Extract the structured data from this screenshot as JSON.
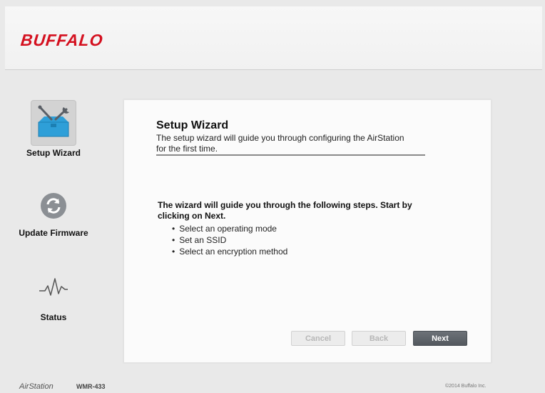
{
  "header": {
    "logo": "BUFFALO"
  },
  "sidebar": {
    "items": [
      {
        "label": "Setup Wizard",
        "icon": "toolbox-wrench-icon",
        "active": true
      },
      {
        "label": "Update Firmware",
        "icon": "refresh-icon",
        "active": false
      },
      {
        "label": "Status",
        "icon": "pulse-icon",
        "active": false
      }
    ]
  },
  "wizard": {
    "title": "Setup Wizard",
    "subtitle": "The setup wizard will guide you through configuring the AirStation for the first time.",
    "intro": "The wizard will guide you through the following steps. Start by clicking on Next.",
    "steps": [
      "Select an operating mode",
      "Set an SSID",
      "Select an encryption method"
    ],
    "buttons": {
      "cancel": "Cancel",
      "back": "Back",
      "next": "Next"
    }
  },
  "footer": {
    "brand": "AirStation",
    "model": "WMR-433",
    "copyright": "©2014 Buffalo Inc."
  },
  "colors": {
    "brand_red": "#d4101f",
    "icon_blue": "#2e9fd8",
    "primary_button": "#5d6268"
  }
}
